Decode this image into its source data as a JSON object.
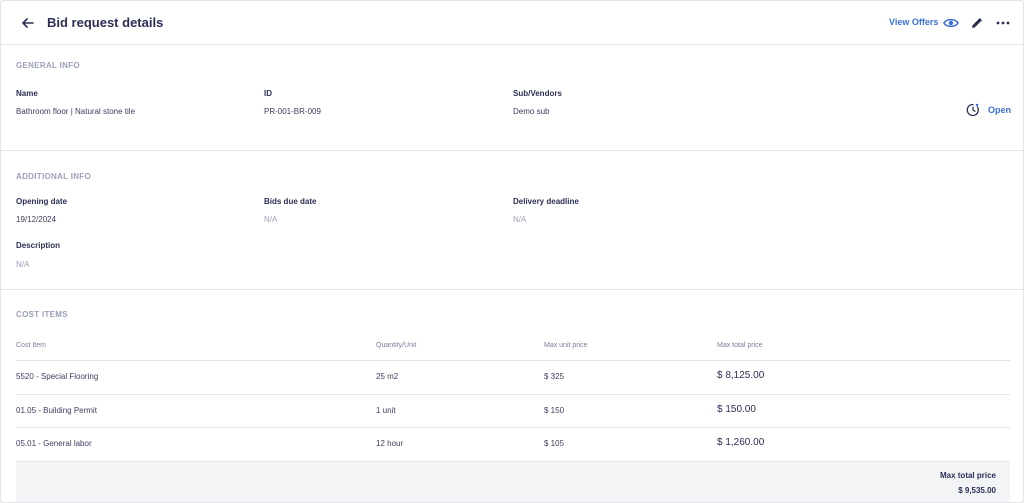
{
  "header": {
    "title": "Bid request details",
    "view_offers_label": "View Offers"
  },
  "general_info": {
    "section_title": "GENERAL INFO",
    "status": "Open",
    "fields": [
      {
        "label": "Name",
        "value": "Bathroom floor | Natural stone tile"
      },
      {
        "label": "ID",
        "value": "PR-001-BR-009"
      },
      {
        "label": "Sub/Vendors",
        "value": "Demo sub"
      }
    ]
  },
  "additional_info": {
    "section_title": "ADDITIONAL INFO",
    "fields": [
      {
        "label": "Opening date",
        "value": "19/12/2024"
      },
      {
        "label": "Bids due date",
        "value": "N/A"
      },
      {
        "label": "Delivery deadline",
        "value": "N/A"
      },
      {
        "label": "Description",
        "value": "N/A"
      }
    ]
  },
  "cost_items": {
    "section_title": "COST ITEMS",
    "columns": [
      "Cost Item",
      "Quantity/Unit",
      "Max unit price",
      "Max total price"
    ],
    "rows": [
      {
        "item": "5520 - Special Flooring",
        "qty": "25 m2",
        "unit_price": "$ 325",
        "total": "$ 8,125.00"
      },
      {
        "item": "01.05 - Building Permit",
        "qty": "1 unit",
        "unit_price": "$ 150",
        "total": "$ 150.00"
      },
      {
        "item": "05.01 - General labor",
        "qty": "12 hour",
        "unit_price": "$ 105",
        "total": "$ 1,260.00"
      }
    ],
    "total_label": "Max total price",
    "total_value": "$ 9,535.00"
  },
  "colors": {
    "accent": "#3a6fd8",
    "text": "#2b2f55",
    "muted": "#9aa0b8"
  },
  "icons": [
    "arrow-left-icon",
    "eye-icon",
    "pencil-icon",
    "more-horizontal-icon",
    "status-clock-icon"
  ]
}
